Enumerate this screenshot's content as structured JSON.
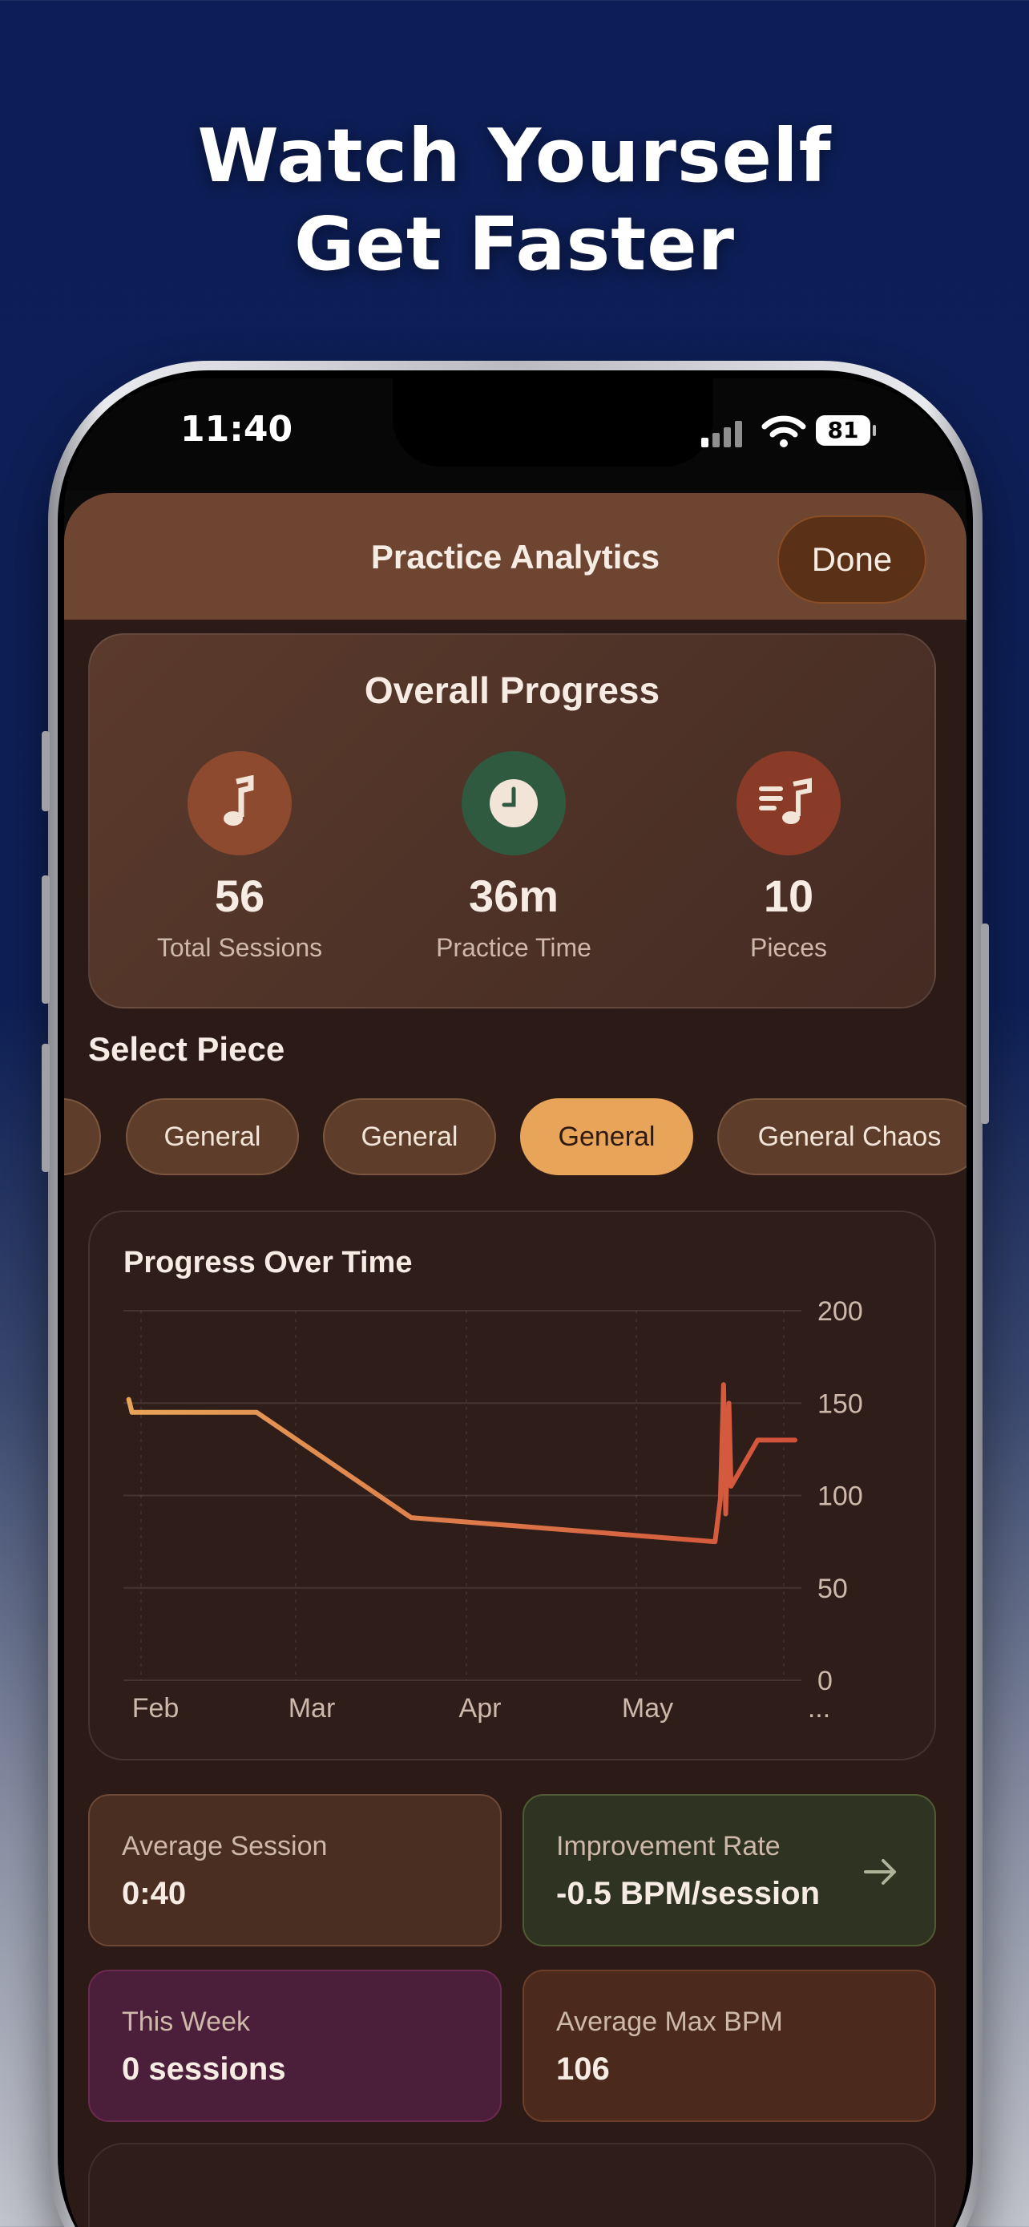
{
  "promo": {
    "line1": "Watch Yourself",
    "line2": "Get Faster"
  },
  "status_bar": {
    "time": "11:40",
    "battery": "81"
  },
  "nav": {
    "title": "Practice Analytics",
    "done_label": "Done"
  },
  "overview": {
    "title": "Overall Progress",
    "stats": [
      {
        "value": "56",
        "label": "Total Sessions",
        "icon": "music-note-icon",
        "color": "#8e4a2e"
      },
      {
        "value": "36m",
        "label": "Practice Time",
        "icon": "clock-icon",
        "color": "#2f5a40"
      },
      {
        "value": "10",
        "label": "Pieces",
        "icon": "music-list-icon",
        "color": "#8a3b28"
      }
    ]
  },
  "pieces": {
    "label": "Select Piece",
    "chips": [
      "General",
      "General",
      "General",
      "General Chaos"
    ],
    "selected_index": 2
  },
  "chart_data": {
    "type": "line",
    "title": "Progress Over Time",
    "x_ticks": [
      "Feb",
      "Mar",
      "Apr",
      "May",
      "..."
    ],
    "y_ticks": [
      "200",
      "150",
      "100",
      "50",
      "0"
    ],
    "ylim": [
      0,
      200
    ],
    "grid": true,
    "series": [
      {
        "points": [
          {
            "x": "Jan 29",
            "y": 152
          },
          {
            "x": "Jan 29",
            "y": 145
          },
          {
            "x": "Feb 22",
            "y": 145
          },
          {
            "x": "Mar 23",
            "y": 88
          },
          {
            "x": "May 19",
            "y": 75
          },
          {
            "x": "May 20",
            "y": 98
          },
          {
            "x": "May 20",
            "y": 160
          },
          {
            "x": "May 21",
            "y": 90
          },
          {
            "x": "May 21",
            "y": 150
          },
          {
            "x": "May 22",
            "y": 105
          },
          {
            "x": "May 27",
            "y": 130
          },
          {
            "x": "Jun 3",
            "y": 130
          }
        ]
      }
    ]
  },
  "metrics": [
    {
      "label": "Average Session",
      "value": "0:40"
    },
    {
      "label": "Improvement Rate",
      "value": "-0.5 BPM/session"
    },
    {
      "label": "This Week",
      "value": "0 sessions"
    },
    {
      "label": "Average Max BPM",
      "value": "106"
    }
  ],
  "colors": {
    "accent": "#e8a55a",
    "line_start": "#e8a55a",
    "line_end": "#d2503a"
  }
}
